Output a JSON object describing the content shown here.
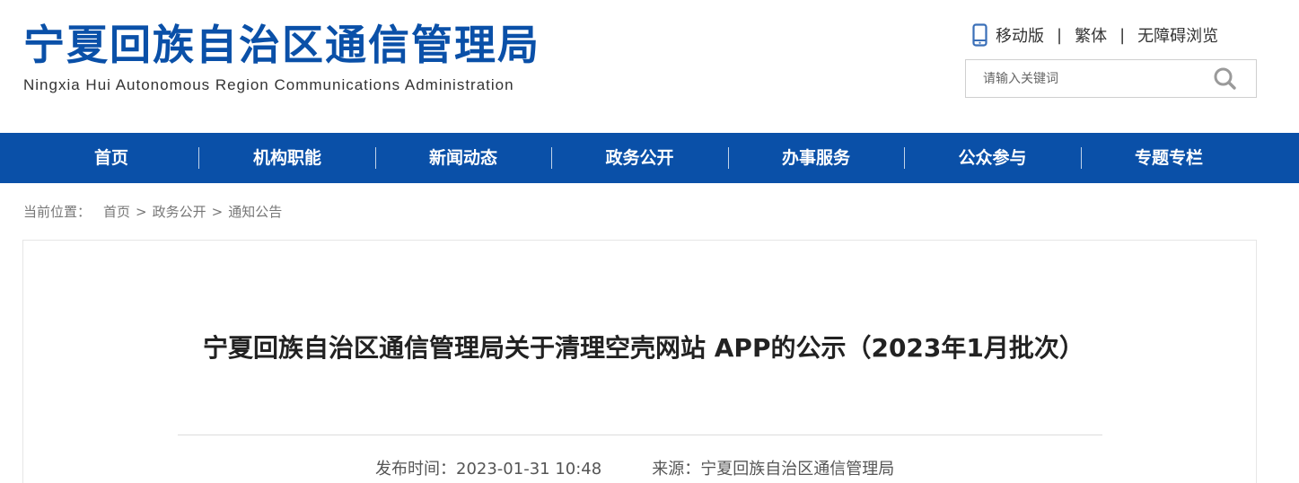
{
  "header": {
    "title_cn": "宁夏回族自治区通信管理局",
    "title_en": "Ningxia Hui Autonomous Region Communications Administration",
    "links": {
      "mobile": "移动版",
      "traditional": "繁体",
      "accessible": "无障碍浏览",
      "separator": "|"
    },
    "search": {
      "placeholder": "请输入关键词",
      "icon": "search-icon"
    },
    "phone_icon": "mobile-phone-icon"
  },
  "nav": {
    "items": [
      {
        "label": "首页"
      },
      {
        "label": "机构职能"
      },
      {
        "label": "新闻动态"
      },
      {
        "label": "政务公开"
      },
      {
        "label": "办事服务"
      },
      {
        "label": "公众参与"
      },
      {
        "label": "专题专栏"
      }
    ]
  },
  "breadcrumb": {
    "label": "当前位置：",
    "items": [
      "首页",
      "政务公开",
      "通知公告"
    ],
    "separator": ">"
  },
  "article": {
    "title": "宁夏回族自治区通信管理局关于清理空壳网站 APP的公示（2023年1月批次）",
    "publish_label": "发布时间：",
    "publish_time": "2023-01-31 10:48",
    "source_label": "来源：",
    "source": "宁夏回族自治区通信管理局"
  },
  "colors": {
    "brand_blue": "#0a50a8",
    "text_dark": "#222222",
    "text_gray": "#777777"
  }
}
